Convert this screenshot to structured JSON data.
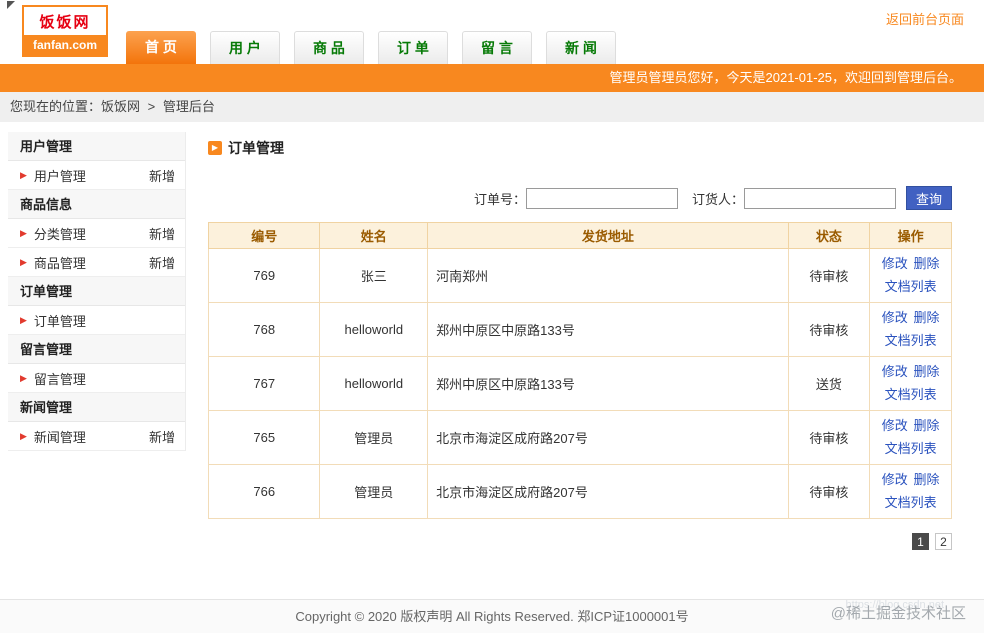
{
  "colors": {
    "accent_orange": "#f8881f",
    "nav_green": "#067a06",
    "logo_red": "#e60012",
    "link_blue": "#2a52be",
    "search_button_blue": "#4161c2",
    "table_header_bg": "#fcf1dc",
    "table_header_text": "#9a5b00",
    "table_border": "#f0d3a2"
  },
  "icons": {
    "sidebar_bullet": "▶",
    "title_bullet": "▶"
  },
  "header": {
    "logo": {
      "title": "饭饭网",
      "domain": "fanfan.com"
    },
    "back_link": "返回前台页面",
    "nav_tabs": [
      {
        "label": "首 页",
        "active": true
      },
      {
        "label": "用 户",
        "active": false
      },
      {
        "label": "商 品",
        "active": false
      },
      {
        "label": "订 单",
        "active": false
      },
      {
        "label": "留 言",
        "active": false
      },
      {
        "label": "新 闻",
        "active": false
      }
    ],
    "welcome_text": "管理员管理员您好，今天是2021-01-25，欢迎回到管理后台。"
  },
  "breadcrumb": {
    "prefix": "您现在的位置：",
    "site": "饭饭网",
    "separator": ">",
    "current": "管理后台"
  },
  "sidebar": {
    "sections": [
      {
        "title": "用户管理",
        "items": [
          {
            "label": "用户管理",
            "action": "新增"
          }
        ]
      },
      {
        "title": "商品信息",
        "items": [
          {
            "label": "分类管理",
            "action": "新增"
          },
          {
            "label": "商品管理",
            "action": "新增"
          }
        ]
      },
      {
        "title": "订单管理",
        "items": [
          {
            "label": "订单管理",
            "action": ""
          }
        ]
      },
      {
        "title": "留言管理",
        "items": [
          {
            "label": "留言管理",
            "action": ""
          }
        ]
      },
      {
        "title": "新闻管理",
        "items": [
          {
            "label": "新闻管理",
            "action": "新增"
          }
        ]
      }
    ]
  },
  "main": {
    "title": "订单管理",
    "search": {
      "order_no_label": "订单号：",
      "buyer_label": "订货人：",
      "button_label": "查询",
      "order_no_value": "",
      "buyer_value": ""
    },
    "table": {
      "headers": [
        "编号",
        "姓名",
        "发货地址",
        "状态",
        "操作"
      ],
      "action_labels": [
        "修改",
        "删除",
        "文档列表"
      ],
      "rows": [
        {
          "id": "769",
          "name": "张三",
          "address": "河南郑州",
          "status": "待审核"
        },
        {
          "id": "768",
          "name": "helloworld",
          "address": "郑州中原区中原路133号",
          "status": "待审核"
        },
        {
          "id": "767",
          "name": "helloworld",
          "address": "郑州中原区中原路133号",
          "status": "送货"
        },
        {
          "id": "765",
          "name": "管理员",
          "address": "北京市海淀区成府路207号",
          "status": "待审核"
        },
        {
          "id": "766",
          "name": "管理员",
          "address": "北京市海淀区成府路207号",
          "status": "待审核"
        }
      ]
    },
    "pagination": {
      "pages": [
        "1",
        "2"
      ],
      "active_page": "1"
    }
  },
  "footer": {
    "copyright": "Copyright © 2020 版权声明 All Rights Reserved. 郑ICP证1000001号"
  },
  "watermark": {
    "community": "@稀土掘金技术社区",
    "url": "https://blog.csdn.net"
  }
}
